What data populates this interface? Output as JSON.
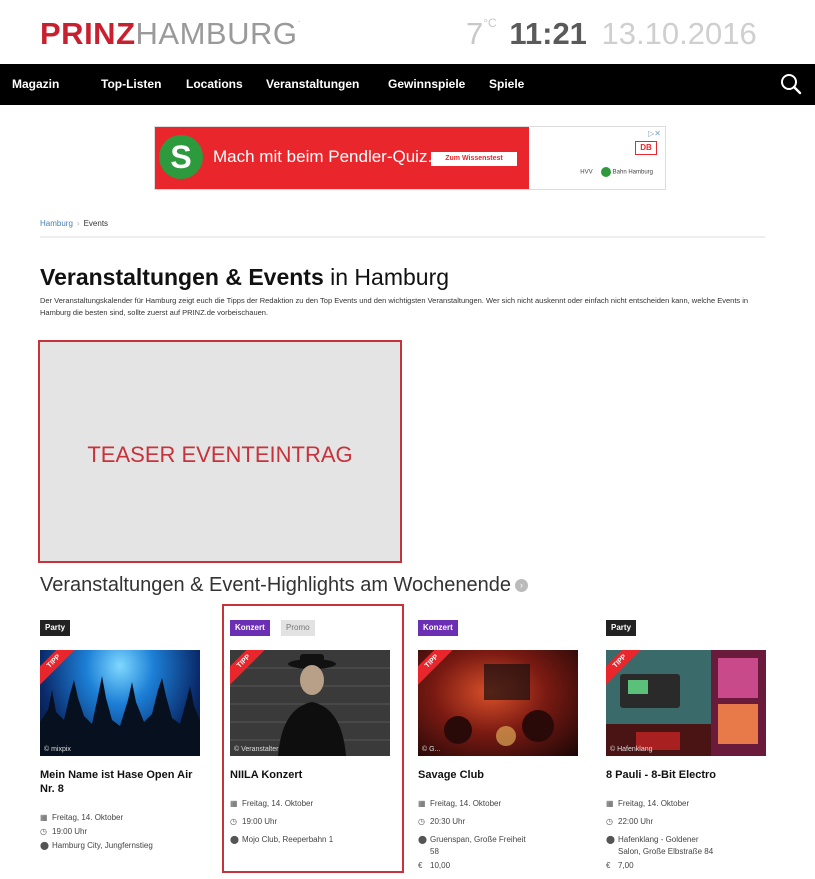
{
  "header": {
    "logo_prinz": "PRINZ",
    "logo_city": "HAMBURG",
    "temperature": "7",
    "temp_unit": "°C",
    "time": "11:21",
    "date": "13.10.2016"
  },
  "nav": {
    "items": [
      "Magazin",
      "Top-Listen",
      "Locations",
      "Veranstaltungen",
      "Gewinnspiele",
      "Spiele"
    ]
  },
  "ad": {
    "logo_letter": "S",
    "text": "Mach mit beim Pendler-Quiz.",
    "button": "Zum Wissenstest",
    "partner1": "HVV",
    "partner2": "Bahn Hamburg",
    "db": "DB"
  },
  "breadcrumb": {
    "home": "Hamburg",
    "current": "Events"
  },
  "page": {
    "title_strong": "Veranstaltungen & Events",
    "title_rest": " in Hamburg",
    "intro": "Der Veranstaltungskalender für Hamburg zeigt euch die Tipps der Redaktion zu den Top Events und den wichtigsten Veranstaltungen. Wer sich nicht auskennt oder einfach nicht entscheiden kann, welche Events in Hamburg die besten sind, sollte zuerst auf PRINZ.de vorbeischauen.",
    "teaser": "TEASER EVENTEINTRAG",
    "section_title": "Veranstaltungen & Event-Highlights am Wochenende"
  },
  "events": [
    {
      "category": "Party",
      "tipp": "TIPP",
      "credit": "© mixpix",
      "title": "Mein Name ist Hase Open Air Nr. 8",
      "date": "Freitag, 14. Oktober",
      "time": "19:00 Uhr",
      "location": "Hamburg City, Jungfernstieg"
    },
    {
      "category": "Konzert",
      "promo": "Promo",
      "tipp": "TIPP",
      "credit": "© Veranstalter",
      "title": "NIILA Konzert",
      "date": "Freitag, 14. Oktober",
      "time": "19:00 Uhr",
      "location": "Mojo Club, Reeperbahn 1"
    },
    {
      "category": "Konzert",
      "tipp": "TIPP",
      "credit": "© G...",
      "title": "Savage Club",
      "date": "Freitag, 14. Oktober",
      "time": "20:30 Uhr",
      "location": "Gruenspan, Große Freiheit",
      "location2": "58",
      "price": "10,00"
    },
    {
      "category": "Party",
      "tipp": "TIPP",
      "credit": "© Hafenklang",
      "title": "8 Pauli - 8-Bit Electro",
      "date": "Freitag, 14. Oktober",
      "time": "22:00 Uhr",
      "location": "Hafenklang - Goldener",
      "location2": "Salon, Große Elbstraße 84",
      "price": "7,00"
    }
  ]
}
